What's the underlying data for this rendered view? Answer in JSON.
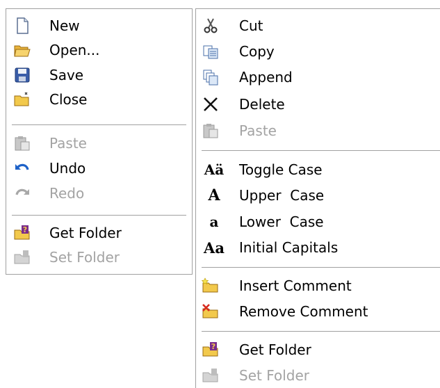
{
  "left_menu": {
    "items": [
      {
        "label": "New",
        "icon": "new-document-icon",
        "enabled": true
      },
      {
        "label": "Open...",
        "icon": "open-folder-icon",
        "enabled": true
      },
      {
        "label": "Save",
        "icon": "save-disk-icon",
        "enabled": true
      },
      {
        "label": "Close",
        "icon": "close-folder-icon",
        "enabled": true
      },
      {
        "label": "Paste",
        "icon": "paste-icon",
        "enabled": false
      },
      {
        "label": "Undo",
        "icon": "undo-icon",
        "enabled": true
      },
      {
        "label": "Redo",
        "icon": "redo-icon",
        "enabled": false
      },
      {
        "label": "Get Folder",
        "icon": "get-folder-icon",
        "enabled": true
      },
      {
        "label": "Set Folder",
        "icon": "set-folder-icon",
        "enabled": false
      }
    ]
  },
  "right_menu": {
    "items": [
      {
        "label": "Cut",
        "icon": "scissors-icon",
        "enabled": true
      },
      {
        "label": "Copy",
        "icon": "copy-icon",
        "enabled": true
      },
      {
        "label": "Append",
        "icon": "append-icon",
        "enabled": true
      },
      {
        "label": "Delete",
        "icon": "delete-x-icon",
        "enabled": true
      },
      {
        "label": "Paste",
        "icon": "paste-icon",
        "enabled": false
      },
      {
        "label": "Toggle Case",
        "icon": "toggle-case-icon",
        "glyph": "Aä",
        "enabled": true
      },
      {
        "label": "Upper  Case",
        "icon": "upper-case-icon",
        "glyph": "A",
        "enabled": true
      },
      {
        "label": "Lower  Case",
        "icon": "lower-case-icon",
        "glyph": "a",
        "enabled": true
      },
      {
        "label": "Initial Capitals",
        "icon": "initial-caps-icon",
        "glyph": "Aa",
        "enabled": true
      },
      {
        "label": "Insert Comment",
        "icon": "insert-comment-icon",
        "enabled": true
      },
      {
        "label": "Remove Comment",
        "icon": "remove-comment-icon",
        "enabled": true
      },
      {
        "label": "Get Folder",
        "icon": "get-folder-icon",
        "enabled": true
      },
      {
        "label": "Set Folder",
        "icon": "set-folder-icon",
        "enabled": false
      }
    ]
  },
  "colors": {
    "border": "#a0a0a0",
    "disabled_text": "#a3a3a3",
    "folder_yellow": "#f2c94c",
    "undo_blue": "#1e62c8",
    "delete_red": "#d62b1f"
  }
}
